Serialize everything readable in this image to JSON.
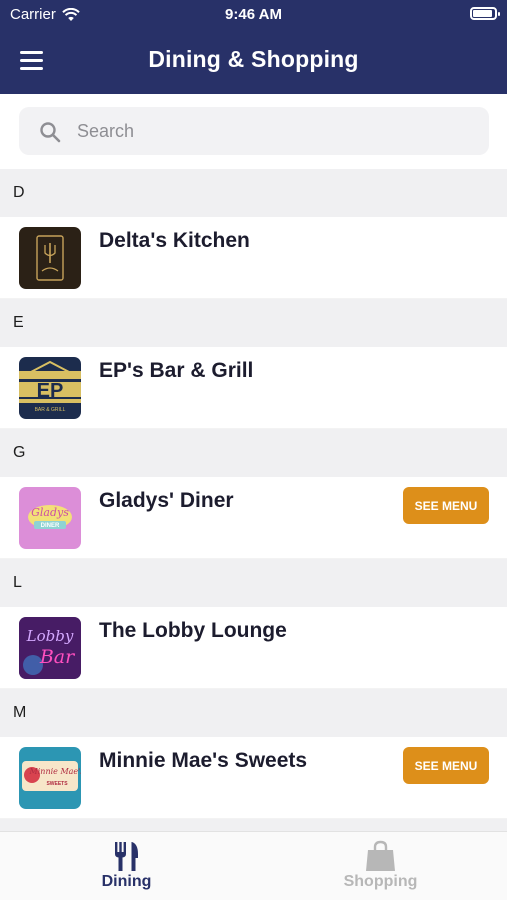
{
  "status_bar": {
    "carrier": "Carrier",
    "time": "9:46 AM"
  },
  "header": {
    "title": "Dining & Shopping",
    "menu_icon": "hamburger-menu-icon"
  },
  "search": {
    "placeholder": "Search",
    "icon": "search-icon"
  },
  "sections": [
    {
      "letter": "D",
      "items": [
        {
          "name": "Delta's Kitchen",
          "logo": "deltas-kitchen-logo"
        }
      ]
    },
    {
      "letter": "E",
      "items": [
        {
          "name": "EP's Bar & Grill",
          "logo": "eps-bar-grill-logo",
          "logo_text": "EP",
          "logo_subtext": "BAR & GRILL"
        }
      ]
    },
    {
      "letter": "G",
      "items": [
        {
          "name": "Gladys' Diner",
          "logo": "gladys-diner-logo",
          "logo_text": "Gladys",
          "logo_subtext": "DINER",
          "button": "SEE MENU"
        }
      ]
    },
    {
      "letter": "L",
      "items": [
        {
          "name": "The Lobby Lounge",
          "logo": "lobby-lounge-logo",
          "logo_text": "Lobby",
          "logo_subtext": "Bar"
        }
      ]
    },
    {
      "letter": "M",
      "items": [
        {
          "name": "Minnie Mae's Sweets",
          "logo": "minnie-maes-sweets-logo",
          "logo_text": "Minnie Mae's",
          "logo_subtext": "SWEETS",
          "button": "SEE MENU"
        }
      ]
    }
  ],
  "tabs": [
    {
      "label": "Dining",
      "icon": "fork-knife-icon",
      "active": true
    },
    {
      "label": "Shopping",
      "icon": "shopping-bag-icon",
      "active": false
    }
  ],
  "colors": {
    "primary": "#283168",
    "accent": "#dd8f1a",
    "section_bg": "#f0f0f2",
    "inactive_tab": "#b7b7b7"
  }
}
